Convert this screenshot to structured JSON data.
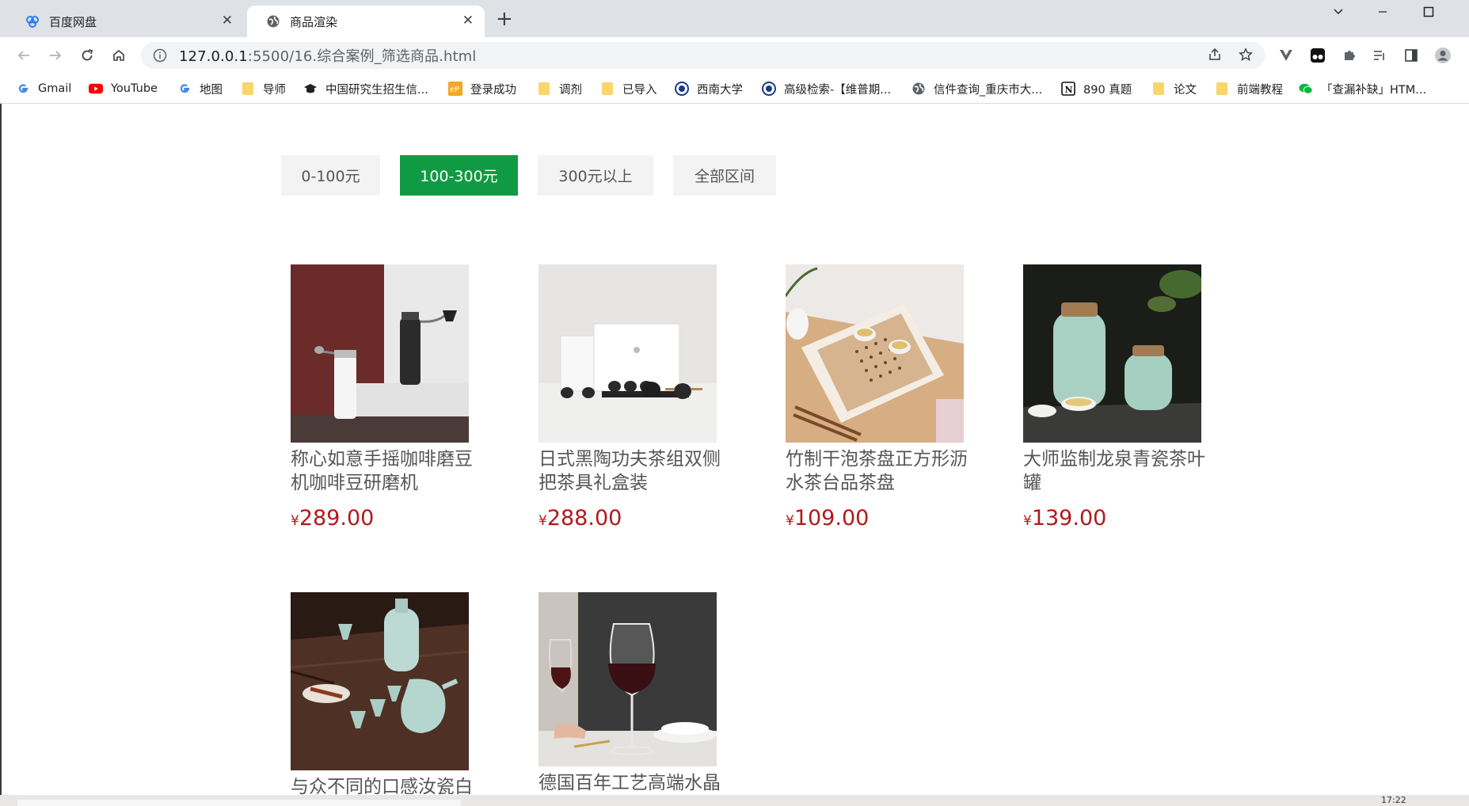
{
  "browser": {
    "tabs": [
      {
        "label": "百度网盘",
        "active": false
      },
      {
        "label": "商品渲染",
        "active": true
      }
    ],
    "url": {
      "host": "127.0.0.1",
      "path": ":5500/16.综合案例_筛选商品.html"
    },
    "bookmarks": [
      {
        "label": "Gmail",
        "icon": "google-g-icon"
      },
      {
        "label": "YouTube",
        "icon": "youtube-icon"
      },
      {
        "label": "地图",
        "icon": "google-g-icon"
      },
      {
        "label": "导师",
        "icon": "folder-icon"
      },
      {
        "label": "中国研究生招生信...",
        "icon": "graduation-cap-icon"
      },
      {
        "label": "登录成功",
        "icon": "ep-icon"
      },
      {
        "label": "调剂",
        "icon": "folder-icon"
      },
      {
        "label": "已导入",
        "icon": "folder-icon"
      },
      {
        "label": "西南大学",
        "icon": "university-seal-icon"
      },
      {
        "label": "高级检索-【维普期...",
        "icon": "university-seal-icon"
      },
      {
        "label": "信件查询_重庆市大...",
        "icon": "globe-icon"
      },
      {
        "label": "890 真题",
        "icon": "notion-icon"
      },
      {
        "label": "论文",
        "icon": "folder-icon"
      },
      {
        "label": "前端教程",
        "icon": "folder-icon"
      },
      {
        "label": "「查漏补缺」HTM...",
        "icon": "wechat-icon"
      }
    ]
  },
  "filters": [
    {
      "label": "0-100元",
      "active": false
    },
    {
      "label": "100-300元",
      "active": true
    },
    {
      "label": "300元以上",
      "active": false
    },
    {
      "label": "全部区间",
      "active": false
    }
  ],
  "products": [
    {
      "name": "称心如意手摇咖啡磨豆机咖啡豆研磨机",
      "currency": "¥",
      "price": "289.00"
    },
    {
      "name": "日式黑陶功夫茶组双侧把茶具礼盒装",
      "currency": "¥",
      "price": "288.00"
    },
    {
      "name": "竹制干泡茶盘正方形沥水茶台品茶盘",
      "currency": "¥",
      "price": "109.00"
    },
    {
      "name": "大师监制龙泉青瓷茶叶罐",
      "currency": "¥",
      "price": "139.00"
    },
    {
      "name": "与众不同的口感汝瓷白",
      "currency": "",
      "price": ""
    },
    {
      "name": "德国百年工艺高端水晶",
      "currency": "",
      "price": ""
    }
  ],
  "taskbar": {
    "time": "17:22"
  },
  "colors": {
    "accent": "#119a44",
    "price": "#b1191a",
    "tabstrip": "#dee1e6"
  }
}
